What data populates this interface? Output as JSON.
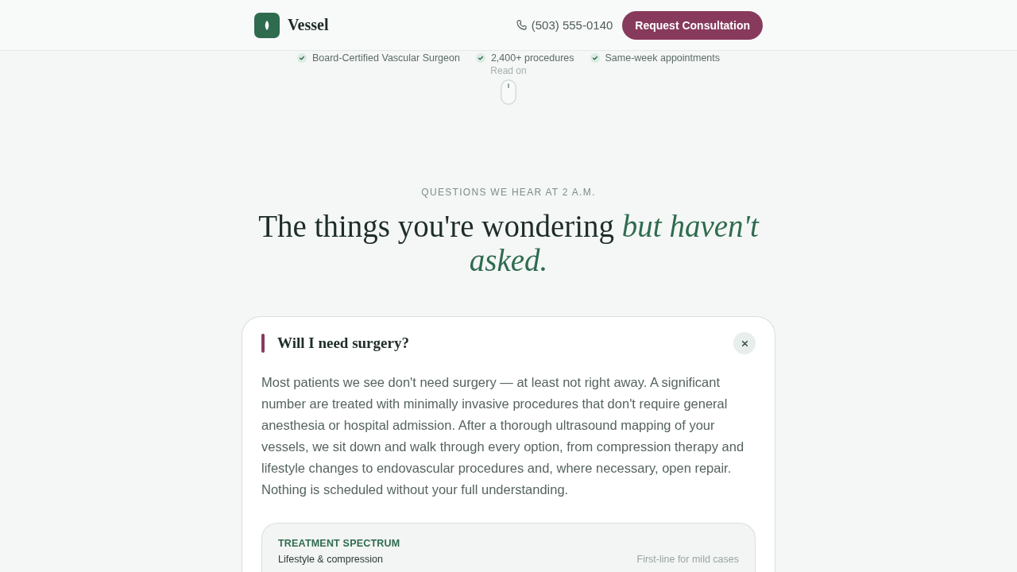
{
  "header": {
    "brand": "Vessel",
    "phone": "(503) 555-0140",
    "cta": "Request Consultation"
  },
  "hero_tail": {
    "trust_items": [
      "Board-Certified Vascular Surgeon",
      "2,400+ procedures",
      "Same-week appointments"
    ],
    "scroll_hint": "Read on"
  },
  "faq": {
    "eyebrow": "QUESTIONS WE HEAR AT 2 A.M.",
    "heading": "The things you're wondering *but haven't asked.*",
    "items": [
      {
        "question": "Will I need surgery?",
        "expanded": true,
        "answer": "Most patients we see don't need surgery — at least not right away. A significant number are treated with minimally invasive procedures that don't require general anesthesia or hospital admission. After a thorough ultrasound mapping of your vessels, we sit down and walk through every option, from compression therapy and lifestyle changes to endovascular procedures and, where necessary, open repair. Nothing is scheduled without your full understanding.",
        "panel": {
          "title": "TREATMENT SPECTRUM",
          "rows": [
            {
              "treatment": "Lifestyle & compression",
              "note": "First-line for mild cases"
            }
          ]
        }
      }
    ]
  }
}
